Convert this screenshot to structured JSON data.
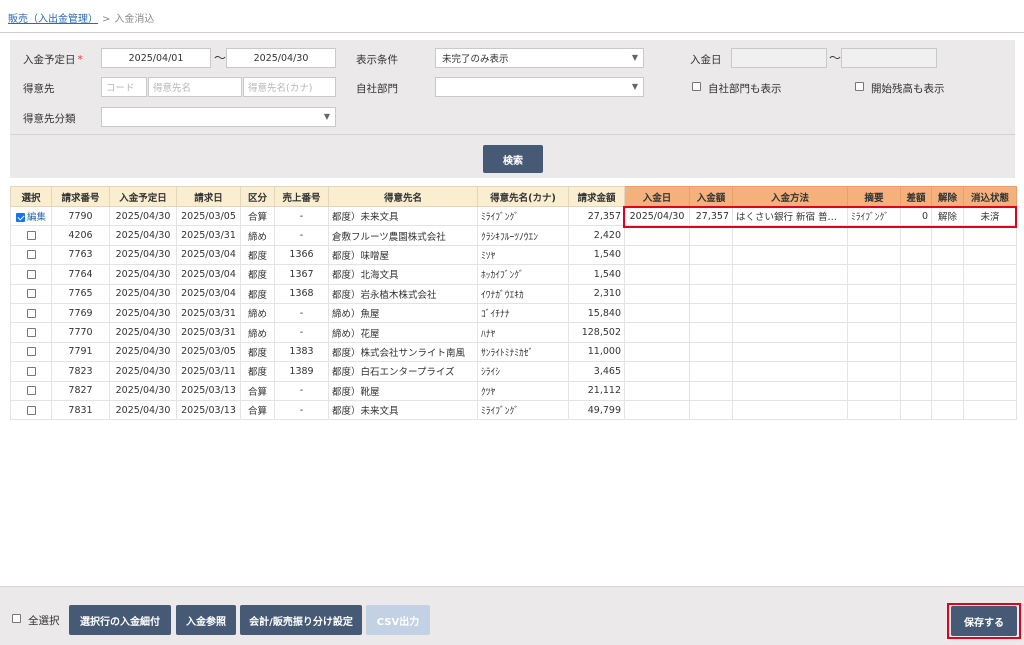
{
  "breadcrumb": {
    "parent": "販売（入出金管理）",
    "separator": ">",
    "current": "入金消込"
  },
  "filter": {
    "due_date_label": "入金予定日",
    "required_mark": "*",
    "due_date_from": "2025/04/01",
    "range_sep": "～",
    "due_date_to": "2025/04/30",
    "display_label": "表示条件",
    "display_value": "未完了のみ表示",
    "payment_date_label": "入金日",
    "customer_label": "得意先",
    "customer_code_ph": "コード",
    "customer_name_ph": "得意先名",
    "customer_kana_ph": "得意先名(カナ)",
    "dept_label": "自社部門",
    "show_dept_label": "自社部門も表示",
    "show_opening_label": "開始残高も表示",
    "category_label": "得意先分類",
    "search_button": "検索"
  },
  "table": {
    "headers": [
      "選択",
      "請求番号",
      "入金予定日",
      "請求日",
      "区分",
      "売上番号",
      "得意先名",
      "得意先名(カナ)",
      "請求金額",
      "入金日",
      "入金額",
      "入金方法",
      "摘要",
      "差額",
      "解除",
      "消込状態"
    ],
    "edit_label": "編集",
    "rows": [
      {
        "checked": true,
        "invoice": "7790",
        "due": "2025/04/30",
        "bill": "2025/03/05",
        "kind": "合算",
        "sales": "-",
        "name": "都度）未来文具",
        "kana": "ﾐﾗｲﾌﾞﾝｸﾞ",
        "amount": "27,357",
        "pay_date": "2025/04/30",
        "pay_amount": "27,357",
        "method": "はくさい銀行 新宿 普通 00...",
        "memo": "ﾐﾗｲﾌﾞﾝｸﾞ",
        "diff": "0",
        "cancel": "解除",
        "status": "未済"
      },
      {
        "checked": false,
        "invoice": "4206",
        "due": "2025/04/30",
        "bill": "2025/03/31",
        "kind": "締め",
        "sales": "-",
        "name": "倉敷フルーツ農園株式会社",
        "kana": "ｸﾗｼｷﾌﾙｰﾂﾉｳｴﾝ",
        "amount": "2,420"
      },
      {
        "checked": false,
        "invoice": "7763",
        "due": "2025/04/30",
        "bill": "2025/03/04",
        "kind": "都度",
        "sales": "1366",
        "name": "都度）味噌屋",
        "kana": "ﾐｿﾔ",
        "amount": "1,540"
      },
      {
        "checked": false,
        "invoice": "7764",
        "due": "2025/04/30",
        "bill": "2025/03/04",
        "kind": "都度",
        "sales": "1367",
        "name": "都度）北海文具",
        "kana": "ﾎｯｶｲﾌﾞﾝｸﾞ",
        "amount": "1,540"
      },
      {
        "checked": false,
        "invoice": "7765",
        "due": "2025/04/30",
        "bill": "2025/03/04",
        "kind": "都度",
        "sales": "1368",
        "name": "都度）岩永植木株式会社",
        "kana": "ｲﾜﾅｶﾞｳｴｷｶ",
        "amount": "2,310"
      },
      {
        "checked": false,
        "invoice": "7769",
        "due": "2025/04/30",
        "bill": "2025/03/31",
        "kind": "締め",
        "sales": "-",
        "name": "締め）魚屋",
        "kana": "ｺﾞｲﾁﾅﾅ",
        "amount": "15,840"
      },
      {
        "checked": false,
        "invoice": "7770",
        "due": "2025/04/30",
        "bill": "2025/03/31",
        "kind": "締め",
        "sales": "-",
        "name": "締め）花屋",
        "kana": "ﾊﾅﾔ",
        "amount": "128,502"
      },
      {
        "checked": false,
        "invoice": "7791",
        "due": "2025/04/30",
        "bill": "2025/03/05",
        "kind": "都度",
        "sales": "1383",
        "name": "都度）株式会社サンライト南風",
        "kana": "ｻﾝﾗｲﾄﾐﾅﾐｶｾﾞ",
        "amount": "11,000"
      },
      {
        "checked": false,
        "invoice": "7823",
        "due": "2025/04/30",
        "bill": "2025/03/11",
        "kind": "都度",
        "sales": "1389",
        "name": "都度）白石エンタープライズ",
        "kana": "ｼﾗｲｼ",
        "amount": "3,465"
      },
      {
        "checked": false,
        "invoice": "7827",
        "due": "2025/04/30",
        "bill": "2025/03/13",
        "kind": "合算",
        "sales": "-",
        "name": "都度）靴屋",
        "kana": "ｸﾂﾔ",
        "amount": "21,112"
      },
      {
        "checked": false,
        "invoice": "7831",
        "due": "2025/04/30",
        "bill": "2025/03/13",
        "kind": "合算",
        "sales": "-",
        "name": "都度）未来文具",
        "kana": "ﾐﾗｲﾌﾞﾝｸﾞ",
        "amount": "49,799"
      }
    ]
  },
  "footer": {
    "select_all": "全選択",
    "btn_detail": "選択行の入金細付",
    "btn_ref": "入金参照",
    "btn_accounting": "会計/販売振り分け設定",
    "btn_csv": "CSV出力",
    "btn_save": "保存する"
  },
  "colors": {
    "accent": "#465a76",
    "header": "#fbeed0",
    "header_payment": "#f4b17c",
    "highlight": "#e3001b"
  }
}
